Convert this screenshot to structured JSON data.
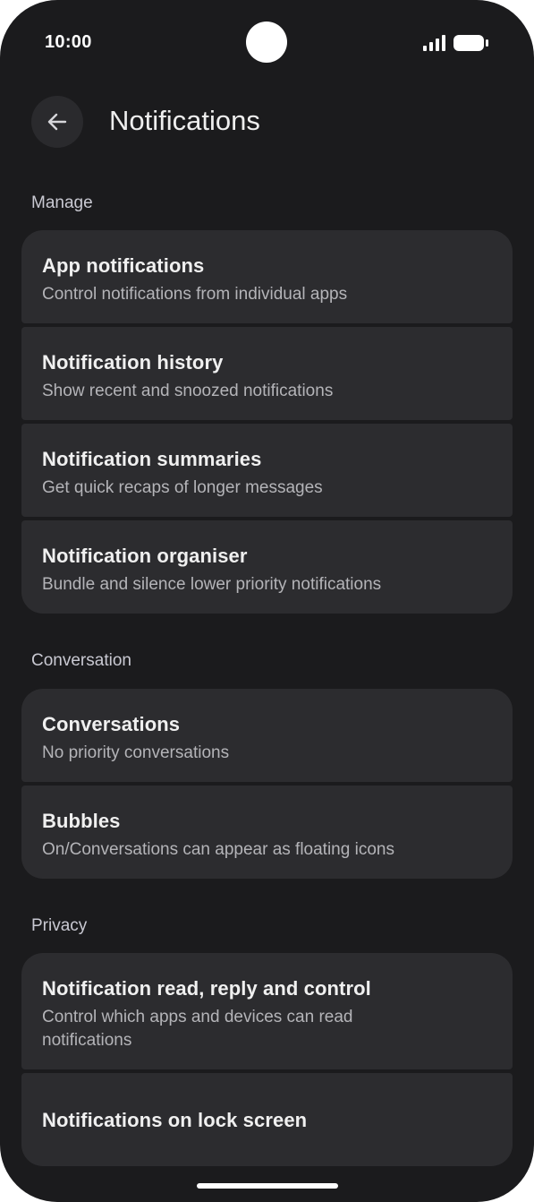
{
  "status_bar": {
    "time": "10:00"
  },
  "header": {
    "title": "Notifications",
    "back_icon": "arrow-left-icon"
  },
  "sections": [
    {
      "label": "Manage",
      "items": [
        {
          "title": "App notifications",
          "subtitle": "Control notifications from individual apps"
        },
        {
          "title": "Notification history",
          "subtitle": "Show recent and snoozed notifications"
        },
        {
          "title": "Notification summaries",
          "subtitle": "Get quick recaps of longer messages"
        },
        {
          "title": "Notification organiser",
          "subtitle": "Bundle and silence lower priority notifications"
        }
      ]
    },
    {
      "label": "Conversation",
      "items": [
        {
          "title": "Conversations",
          "subtitle": "No priority conversations"
        },
        {
          "title": "Bubbles",
          "subtitle": "On/Conversations can appear as floating icons"
        }
      ]
    },
    {
      "label": "Privacy",
      "items": [
        {
          "title": "Notification read, reply and control",
          "subtitle": "Control which apps and devices can read notifications"
        },
        {
          "title": "Notifications on lock screen"
        }
      ]
    }
  ],
  "colors": {
    "background": "#1b1b1d",
    "card": "#2c2c2f",
    "text": "#f0f0f0",
    "secondary_text": "#b4b4b8"
  }
}
